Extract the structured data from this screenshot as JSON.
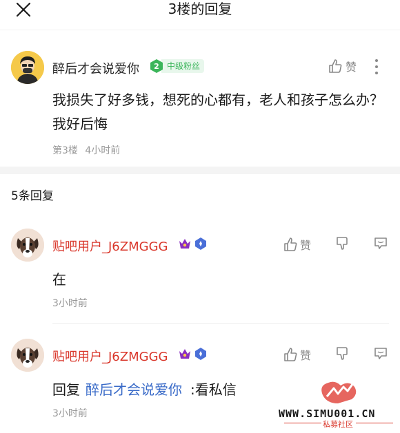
{
  "header": {
    "title": "3楼的回复"
  },
  "main_post": {
    "username": "醉后才会说爱你",
    "fan_level": "2",
    "fan_label": "中级粉丝",
    "like_label": "赞",
    "content": "我损失了好多钱，想死的心都有，老人和孩子怎么办？我好后悔",
    "floor": "第3楼",
    "time": "4小时前"
  },
  "reply_count": "5条回复",
  "replies": [
    {
      "username": "贴吧用户_J6ZMGGG",
      "like_label": "赞",
      "text": "在",
      "time": "3小时前"
    },
    {
      "username": "贴吧用户_J6ZMGGG",
      "like_label": "赞",
      "prefix": "回复",
      "mention": "醉后才会说爱你",
      "text": ":看私信",
      "time": "3小时前"
    }
  ],
  "watermark": {
    "url": "WWW.SIMU001.CN",
    "sub": "私募社区"
  },
  "colors": {
    "username_red": "#d9362a",
    "fan_green": "#3bb55a",
    "mention_blue": "#3a6bc8",
    "meta_gray": "#999999"
  }
}
